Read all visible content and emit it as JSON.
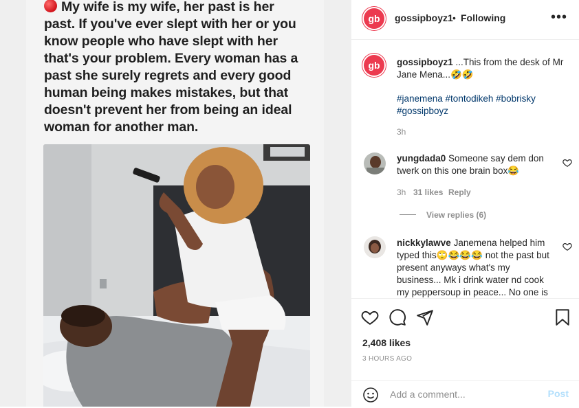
{
  "post": {
    "image_text_lines": [
      "My wife is my wife, her past is her",
      "past. If you've ever slept with her or you",
      "know people who have slept with her",
      "that's your problem. Every woman has a",
      "past she surely regrets and every good",
      "human being makes mistakes, but that",
      "doesn't prevent her from being an ideal",
      "woman for another man."
    ]
  },
  "header": {
    "logo_text": "gb",
    "username": "gossipboyz1",
    "separator": "•",
    "follow_status": "Following",
    "more_icon": "more-horizontal-icon"
  },
  "caption": {
    "username": "gossipboyz1",
    "text_line1": " ...This from the desk of Mr",
    "text_line2": "Jane Mena...🤣🤣",
    "hashtags_line1": "#janemena #tontodikeh #bobrisky",
    "hashtags_line2": "#gossipboyz",
    "time": "3h"
  },
  "comments": [
    {
      "username": "yungdada0",
      "line1": " Someone say dem don",
      "line2": "twerk on this one brain box😂",
      "time": "3h",
      "likes": "31 likes",
      "reply": "Reply",
      "view_replies": "View replies (6)"
    },
    {
      "username": "nickkylawve",
      "line1": " Janemena helped him",
      "line2": "typed this🙄😂😂😂 not the past but",
      "line3": "present anyways what's my",
      "line4": "business... Mk i drink water nd cook",
      "line5": "my peppersoup in peace... No one is"
    }
  ],
  "actions": {
    "likes": "2,408 likes",
    "time": "3 HOURS AGO",
    "add_comment_placeholder": "Add a comment...",
    "post_label": "Post"
  },
  "colors": {
    "brand": "#ec3a4f",
    "hashtag": "#00376b",
    "muted": "#8e8e8e",
    "post_disabled": "#b2dffc"
  }
}
